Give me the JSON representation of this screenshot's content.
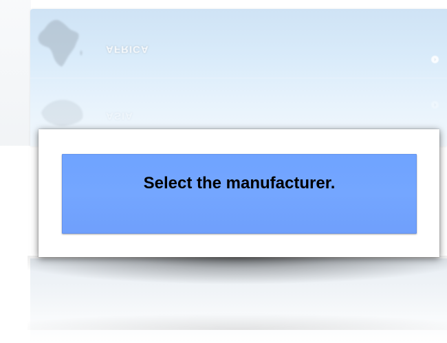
{
  "background": {
    "regions": [
      {
        "label": "AFRICA",
        "icon": "africa-map-icon"
      },
      {
        "label": "ASIA",
        "icon": "asia-map-icon"
      }
    ],
    "chevron_glyph": "›",
    "colors": {
      "list_top": "#cfe3f5",
      "list_bottom": "#f2f8fd"
    }
  },
  "dialog": {
    "message": "Select the manufacturer.",
    "colors": {
      "panel": "#72a5ff",
      "text": "#000000",
      "dialog_bg": "#ffffff"
    }
  }
}
